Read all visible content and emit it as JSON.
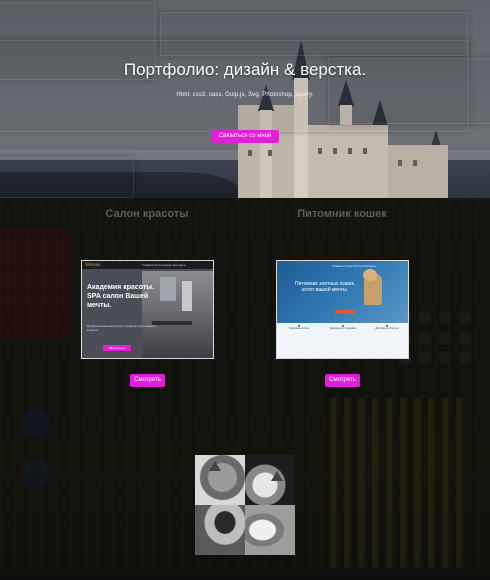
{
  "hero": {
    "title": "Портфолио: дизайн & верстка.",
    "subtitle": "Html, css3, sass, Gulp.js, Svg, Photoshop, jquery.",
    "button_label": "Связаться со мной"
  },
  "projects": [
    {
      "title": "Салон красоты",
      "preview": {
        "logo": "Venus",
        "menu": "Главная   Услуги   Цены   Контакты",
        "headline": "Академия красоты. SPA салон Вашей мечты.",
        "text": "Профессиональный уход и комфорт для каждого клиента",
        "button": "Записаться"
      },
      "button_label": "Смотреть"
    },
    {
      "title": "Питомник кошек",
      "preview": {
        "menu": "Главная   О нас   Котята   Контакты",
        "headline": "Питомник элитных кошек, котят вашей мечты.",
        "features": [
          "Здоровые котята",
          "Документы и прививки",
          "Доставка по России"
        ]
      },
      "button_label": "Смотреть"
    }
  ],
  "colors": {
    "accent": "#e21ed6",
    "hero_text": "#ffffff",
    "section_title": "#5d5d5d"
  }
}
